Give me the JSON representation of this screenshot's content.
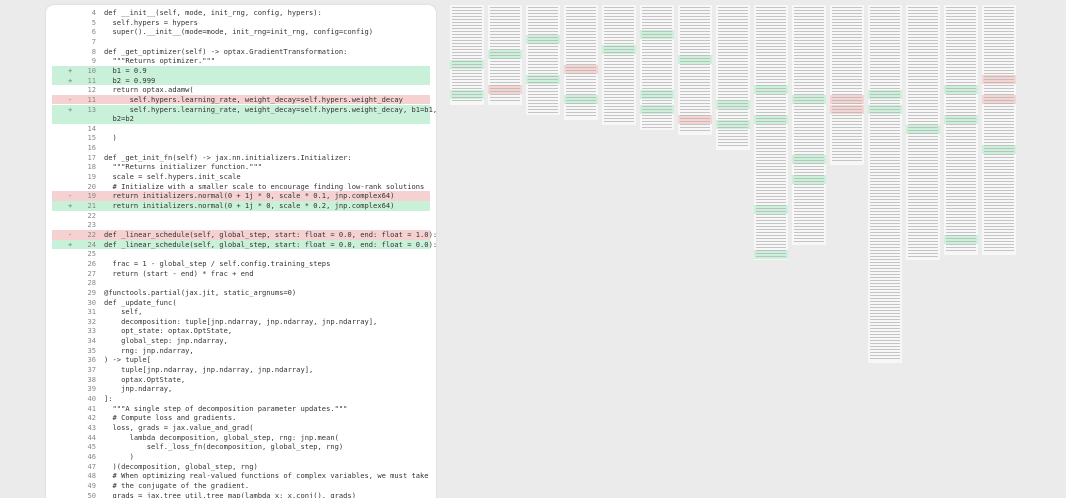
{
  "diff": {
    "lines": [
      {
        "num": "4",
        "mark": "",
        "type": "ctx",
        "code": "def __init__(self, mode, init_rng, config, hypers):"
      },
      {
        "num": "5",
        "mark": "",
        "type": "ctx",
        "code": "  self.hypers = hypers"
      },
      {
        "num": "6",
        "mark": "",
        "type": "ctx",
        "code": "  super().__init__(mode=mode, init_rng=init_rng, config=config)"
      },
      {
        "num": "7",
        "mark": "",
        "type": "ctx",
        "code": ""
      },
      {
        "num": "8",
        "mark": "",
        "type": "ctx",
        "code": "def _get_optimizer(self) -> optax.GradientTransformation:"
      },
      {
        "num": "9",
        "mark": "",
        "type": "ctx",
        "code": "  \"\"\"Returns optimizer.\"\"\""
      },
      {
        "num": "10",
        "mark": "+",
        "type": "add",
        "code": "  b1 = 0.9"
      },
      {
        "num": "11",
        "mark": "+",
        "type": "add",
        "code": "  b2 = 0.999"
      },
      {
        "num": "12",
        "mark": "",
        "type": "ctx",
        "code": "  return optax.adamw("
      },
      {
        "num": "11",
        "mark": "-",
        "type": "del",
        "code": "      self.hypers.learning_rate, weight_decay=self.hypers.weight_decay"
      },
      {
        "num": "13",
        "mark": "+",
        "type": "add",
        "code": "      self.hypers.learning_rate, weight_decay=self.hypers.weight_decay, b1=b1,"
      },
      {
        "num": "",
        "mark": "",
        "type": "add",
        "code": "  b2=b2"
      },
      {
        "num": "14",
        "mark": "",
        "type": "ctx",
        "code": ""
      },
      {
        "num": "15",
        "mark": "",
        "type": "ctx",
        "code": "  )"
      },
      {
        "num": "16",
        "mark": "",
        "type": "ctx",
        "code": ""
      },
      {
        "num": "17",
        "mark": "",
        "type": "ctx",
        "code": "def _get_init_fn(self) -> jax.nn.initializers.Initializer:"
      },
      {
        "num": "18",
        "mark": "",
        "type": "ctx",
        "code": "  \"\"\"Returns initializer function.\"\"\""
      },
      {
        "num": "19",
        "mark": "",
        "type": "ctx",
        "code": "  scale = self.hypers.init_scale"
      },
      {
        "num": "20",
        "mark": "",
        "type": "ctx",
        "code": "  # Initialize with a smaller scale to encourage finding low-rank solutions"
      },
      {
        "num": "19",
        "mark": "-",
        "type": "del",
        "code": "  return initializers.normal(0 + 1j * 0, scale * 0.1, jnp.complex64)"
      },
      {
        "num": "21",
        "mark": "+",
        "type": "add",
        "code": "  return initializers.normal(0 + 1j * 0, scale * 0.2, jnp.complex64)"
      },
      {
        "num": "22",
        "mark": "",
        "type": "ctx",
        "code": ""
      },
      {
        "num": "23",
        "mark": "",
        "type": "ctx",
        "code": ""
      },
      {
        "num": "22",
        "mark": "-",
        "type": "del",
        "code": "def _linear_schedule(self, global_step, start: float = 0.0, end: float = 1.0):"
      },
      {
        "num": "24",
        "mark": "+",
        "type": "add",
        "code": "def _linear_schedule(self, global_step, start: float = 0.0, end: float = 0.0):"
      },
      {
        "num": "25",
        "mark": "",
        "type": "ctx",
        "code": ""
      },
      {
        "num": "26",
        "mark": "",
        "type": "ctx",
        "code": "  frac = 1 - global_step / self.config.training_steps"
      },
      {
        "num": "27",
        "mark": "",
        "type": "ctx",
        "code": "  return (start - end) * frac + end"
      },
      {
        "num": "28",
        "mark": "",
        "type": "ctx",
        "code": ""
      },
      {
        "num": "29",
        "mark": "",
        "type": "ctx",
        "code": "@functools.partial(jax.jit, static_argnums=0)"
      },
      {
        "num": "30",
        "mark": "",
        "type": "ctx",
        "code": "def _update_func("
      },
      {
        "num": "31",
        "mark": "",
        "type": "ctx",
        "code": "    self,"
      },
      {
        "num": "32",
        "mark": "",
        "type": "ctx",
        "code": "    decomposition: tuple[jnp.ndarray, jnp.ndarray, jnp.ndarray],"
      },
      {
        "num": "33",
        "mark": "",
        "type": "ctx",
        "code": "    opt_state: optax.OptState,"
      },
      {
        "num": "34",
        "mark": "",
        "type": "ctx",
        "code": "    global_step: jnp.ndarray,"
      },
      {
        "num": "35",
        "mark": "",
        "type": "ctx",
        "code": "    rng: jnp.ndarray,"
      },
      {
        "num": "36",
        "mark": "",
        "type": "ctx",
        "code": ") -> tuple["
      },
      {
        "num": "37",
        "mark": "",
        "type": "ctx",
        "code": "    tuple[jnp.ndarray, jnp.ndarray, jnp.ndarray],"
      },
      {
        "num": "38",
        "mark": "",
        "type": "ctx",
        "code": "    optax.OptState,"
      },
      {
        "num": "39",
        "mark": "",
        "type": "ctx",
        "code": "    jnp.ndarray,"
      },
      {
        "num": "40",
        "mark": "",
        "type": "ctx",
        "code": "]:"
      },
      {
        "num": "41",
        "mark": "",
        "type": "ctx",
        "code": "  \"\"\"A single step of decomposition parameter updates.\"\"\""
      },
      {
        "num": "42",
        "mark": "",
        "type": "ctx",
        "code": "  # Compute loss and gradients."
      },
      {
        "num": "43",
        "mark": "",
        "type": "ctx",
        "code": "  loss, grads = jax.value_and_grad("
      },
      {
        "num": "44",
        "mark": "",
        "type": "ctx",
        "code": "      lambda decomposition, global_step, rng: jnp.mean("
      },
      {
        "num": "45",
        "mark": "",
        "type": "ctx",
        "code": "          self._loss_fn(decomposition, global_step, rng)"
      },
      {
        "num": "46",
        "mark": "",
        "type": "ctx",
        "code": "      )"
      },
      {
        "num": "47",
        "mark": "",
        "type": "ctx",
        "code": "  )(decomposition, global_step, rng)"
      },
      {
        "num": "48",
        "mark": "",
        "type": "ctx",
        "code": "  # When optimizing real-valued functions of complex variables, we must take"
      },
      {
        "num": "49",
        "mark": "",
        "type": "ctx",
        "code": "  # the conjugate of the gradient."
      },
      {
        "num": "50",
        "mark": "",
        "type": "ctx",
        "code": "  grads = jax.tree_util.tree_map(lambda x: x.conj(), grads)"
      }
    ]
  },
  "colors": {
    "added_bg": "#c9f1d9",
    "removed_bg": "#f6d1d1",
    "page_bg": "#ebebeb"
  }
}
